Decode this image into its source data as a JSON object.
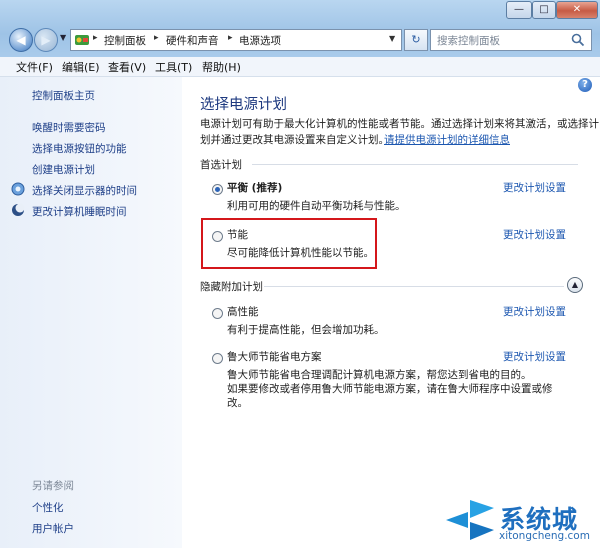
{
  "window": {
    "minimize": "—",
    "maximize": "□",
    "close": "✕"
  },
  "address": {
    "breadcrumb": [
      "控制面板",
      "硬件和声音",
      "电源选项"
    ],
    "sep": "▸"
  },
  "search": {
    "placeholder": "搜索控制面板"
  },
  "menu": [
    "文件(F)",
    "编辑(E)",
    "查看(V)",
    "工具(T)",
    "帮助(H)"
  ],
  "sidebar": {
    "home": "控制面板主页",
    "items": [
      "唤醒时需要密码",
      "选择电源按钮的功能",
      "创建电源计划",
      "选择关闭显示器的时间",
      "更改计算机睡眠时间"
    ],
    "see_also_title": "另请参阅",
    "see_also": [
      "个性化",
      "用户帐户"
    ]
  },
  "main": {
    "title": "选择电源计划",
    "desc_line1": "电源计划可有助于最大化计算机的性能或者节能。通过选择计划来将其激活，或选择计",
    "desc_line2": "划并通过更改其电源设置来自定义计划。",
    "desc_link": "请提供电源计划的详细信息",
    "preferred_title": "首选计划",
    "hidden_title": "隐藏附加计划",
    "change_link": "更改计划设置",
    "plans": [
      {
        "name": "平衡 (推荐)",
        "desc": [
          "利用可用的硬件自动平衡功耗与性能。"
        ],
        "selected": true
      },
      {
        "name": "节能",
        "desc": [
          "尽可能降低计算机性能以节能。"
        ],
        "selected": false
      },
      {
        "name": "高性能",
        "desc": [
          "有利于提高性能，但会增加功耗。"
        ],
        "selected": false
      },
      {
        "name": "鲁大师节能省电方案",
        "desc": [
          "鲁大师节能省电合理调配计算机电源方案，帮您达到省电的目的。",
          "如果要修改或者停用鲁大师节能电源方案，请在鲁大师程序中设置或修",
          "改。"
        ],
        "selected": false
      }
    ]
  },
  "watermark": {
    "brand": "系统城",
    "url": "xitongcheng.com"
  },
  "colors": {
    "accent_link": "#1c57b0",
    "title_blue": "#1e3a80",
    "highlight_red": "#d4171b"
  }
}
